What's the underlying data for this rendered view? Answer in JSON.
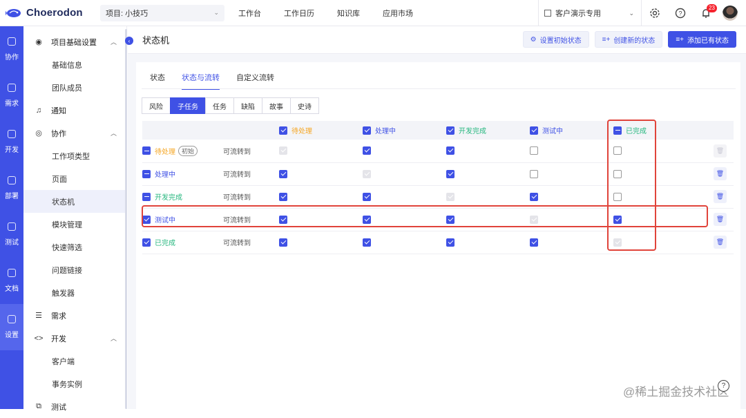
{
  "app": {
    "brand": "Choerodon",
    "project_select": "项目: 小技巧",
    "nav": [
      "工作台",
      "工作日历",
      "知识库",
      "应用市场"
    ],
    "org_select": "客户演示专用",
    "notification_count": "23"
  },
  "leftbar": [
    {
      "label": "协作",
      "icon": "collab-icon"
    },
    {
      "label": "需求",
      "icon": "layers-icon"
    },
    {
      "label": "开发",
      "icon": "code-icon"
    },
    {
      "label": "部署",
      "icon": "deploy-icon"
    },
    {
      "label": "测试",
      "icon": "clipboard-icon"
    },
    {
      "label": "文档",
      "icon": "doc-icon"
    },
    {
      "label": "设置",
      "icon": "settings-icon"
    }
  ],
  "sidebar": {
    "groups": [
      {
        "label": "项目基础设置",
        "expanded": true,
        "items": [
          "基础信息",
          "团队成员"
        ]
      },
      {
        "label": "通知",
        "expanded": false,
        "items": []
      },
      {
        "label": "协作",
        "expanded": true,
        "items": [
          "工作项类型",
          "页面",
          "状态机",
          "模块管理",
          "快速筛选",
          "问题链接",
          "触发器"
        ]
      },
      {
        "label": "需求",
        "expanded": false,
        "items": []
      },
      {
        "label": "开发",
        "expanded": true,
        "items": [
          "客户端",
          "事务实例"
        ]
      },
      {
        "label": "测试",
        "expanded": false,
        "items": []
      }
    ],
    "active_item": "状态机"
  },
  "page": {
    "title": "状态机",
    "actions": [
      "设置初始状态",
      "创建新的状态",
      "添加已有状态"
    ],
    "tabs": [
      "状态",
      "状态与流转",
      "自定义流转"
    ],
    "active_tab": "状态与流转",
    "issue_types": [
      "风险",
      "子任务",
      "任务",
      "缺陷",
      "故事",
      "史诗"
    ],
    "active_type": "子任务"
  },
  "matrix": {
    "columns": [
      {
        "label": "待处理",
        "color": "#f5a623"
      },
      {
        "label": "处理中",
        "color": "#3f51e5"
      },
      {
        "label": "开发完成",
        "color": "#27b77f"
      },
      {
        "label": "测试中",
        "color": "#3f51e5"
      },
      {
        "label": "已完成",
        "color": "#27b77f"
      }
    ],
    "transition_label": "可流转到",
    "initial_tag": "初始",
    "rows": [
      {
        "label": "待处理",
        "color": "#f5a623",
        "check": "minus",
        "initial": true,
        "cells": [
          "dis",
          "on",
          "on",
          "off",
          "off"
        ],
        "delete_enabled": false
      },
      {
        "label": "处理中",
        "color": "#3f51e5",
        "check": "minus",
        "initial": false,
        "cells": [
          "on",
          "dis",
          "on",
          "off",
          "off"
        ],
        "delete_enabled": true
      },
      {
        "label": "开发完成",
        "color": "#27b77f",
        "check": "minus",
        "initial": false,
        "cells": [
          "on",
          "on",
          "dis",
          "on",
          "off"
        ],
        "delete_enabled": true
      },
      {
        "label": "测试中",
        "color": "#3f51e5",
        "check": "on",
        "initial": false,
        "cells": [
          "on",
          "on",
          "on",
          "dis",
          "on"
        ],
        "delete_enabled": true
      },
      {
        "label": "已完成",
        "color": "#27b77f",
        "check": "on",
        "initial": false,
        "cells": [
          "on",
          "on",
          "on",
          "on",
          "dis"
        ],
        "delete_enabled": true
      }
    ]
  },
  "watermark": "@稀土掘金技术社区"
}
